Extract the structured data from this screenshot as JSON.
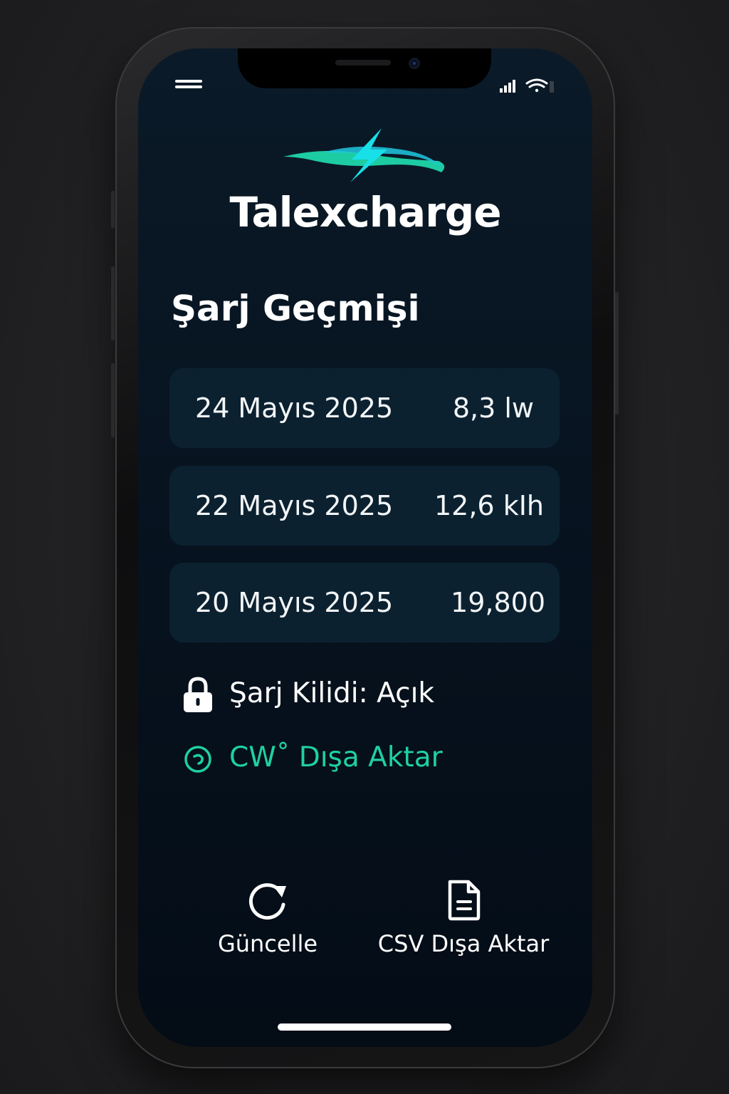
{
  "app": {
    "name": "Talexcharge"
  },
  "header": {
    "section_title": "Şarj Geçmişi"
  },
  "history": [
    {
      "date": "24 Mayıs 2025",
      "value": "8,3 lw"
    },
    {
      "date": "22 Mayıs 2025",
      "value": "12,6 kIh"
    },
    {
      "date": "20 Mayıs 2025",
      "value": "19,800"
    }
  ],
  "lock_status": {
    "label": "Şarj Kilidi: Açık",
    "icon": "lock-icon"
  },
  "export_link": {
    "label": "CW˚ Dışa Aktar",
    "icon": "circle-arrow-icon"
  },
  "actions": {
    "refresh_label": "Güncelle",
    "csv_export_label": "CSV Dışa Aktar"
  },
  "colors": {
    "accent": "#1fd0a3",
    "logo_bolt": "#18e0e8",
    "background": "#06121e",
    "card": "#0c2130"
  }
}
